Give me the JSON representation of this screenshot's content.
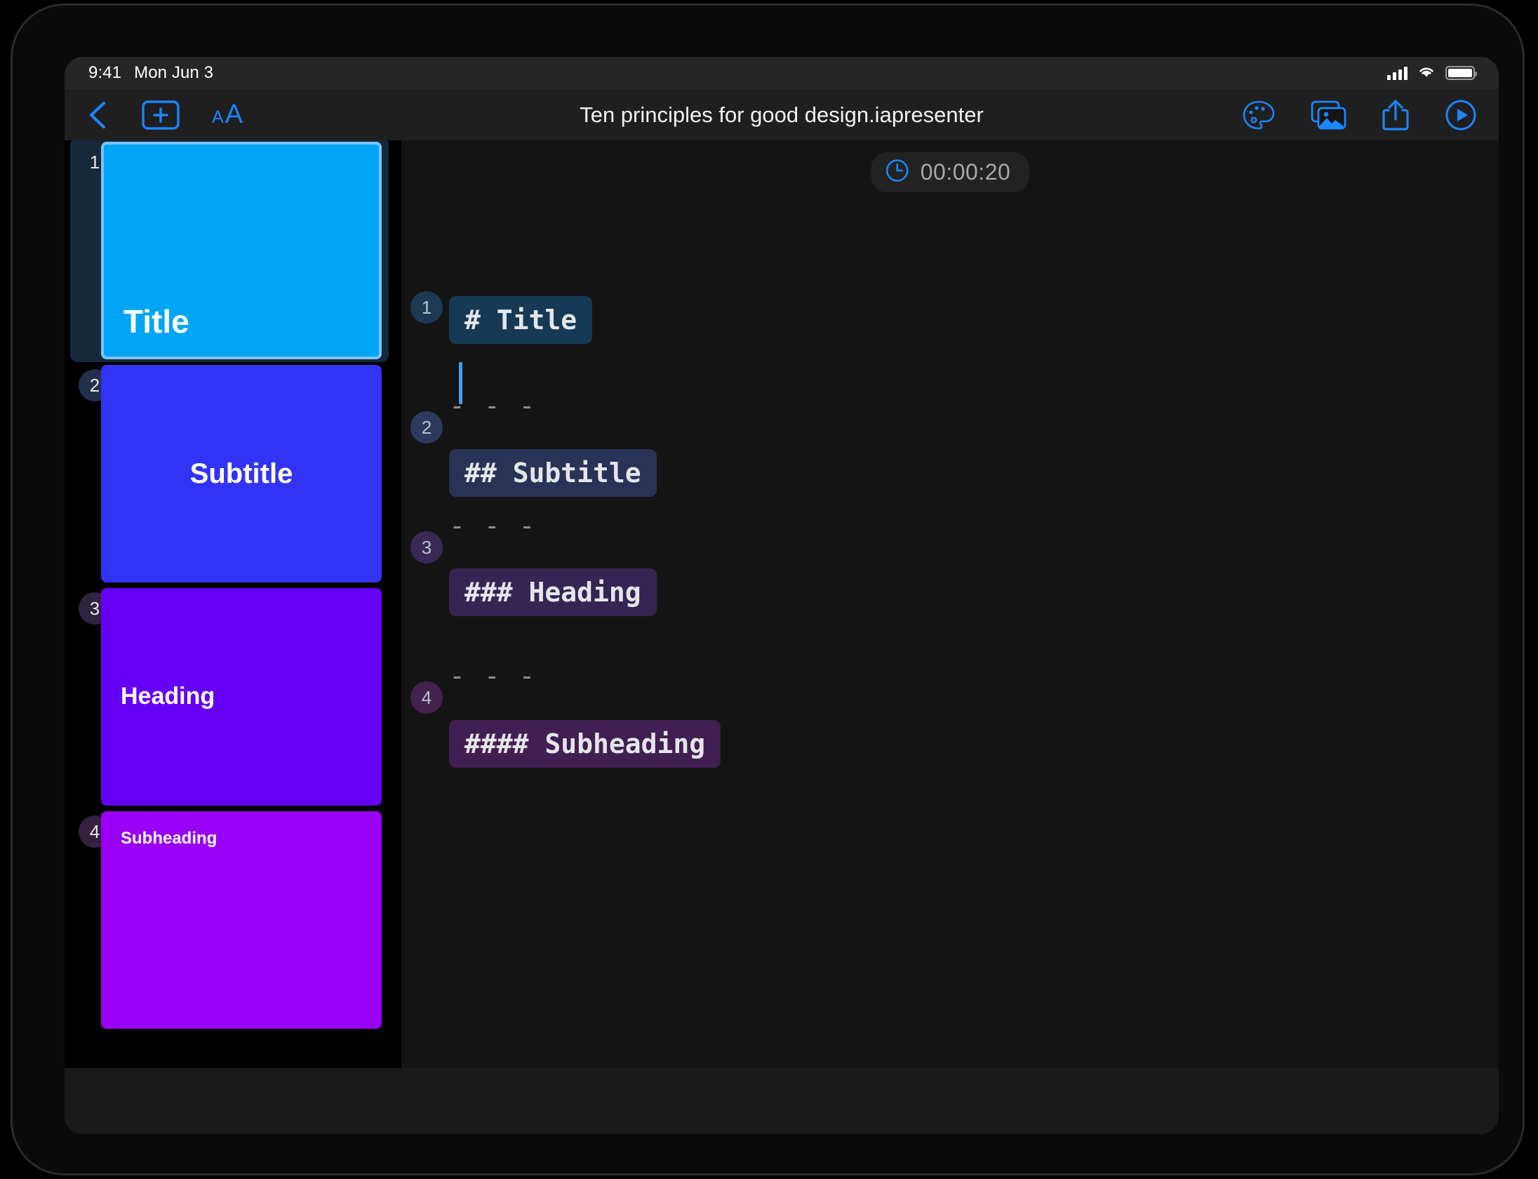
{
  "status_bar": {
    "time": "9:41",
    "date": "Mon Jun 3",
    "icons": [
      "cellular-signal-icon",
      "wifi-icon",
      "battery-icon"
    ]
  },
  "toolbar": {
    "back_icon": "chevron-left-icon",
    "add_slide_icon": "add-slide-icon",
    "text_size_small": "A",
    "text_size_large": "A",
    "document_title": "Ten principles for good design.iapresenter",
    "theme_icon": "palette-icon",
    "media_icon": "photos-icon",
    "share_icon": "share-icon",
    "play_icon": "play-icon"
  },
  "timer": {
    "icon": "clock-icon",
    "value": "00:00:20"
  },
  "sidebar": {
    "slides": [
      {
        "number": "1",
        "text": "Title",
        "bg": "#00A5F5",
        "selected": true,
        "align": "pos-bl",
        "font_size": "46px"
      },
      {
        "number": "2",
        "text": "Subtitle",
        "bg": "#3333F5",
        "selected": false,
        "align": "pos-c",
        "font_size": "40px"
      },
      {
        "number": "3",
        "text": "Heading",
        "bg": "#6600F5",
        "selected": false,
        "align": "pos-cl",
        "font_size": "34px"
      },
      {
        "number": "4",
        "text": "Subheading",
        "bg": "#9900F5",
        "selected": false,
        "align": "pos-tl",
        "font_size": "24px"
      }
    ],
    "badge_colors": [
      "#16293a",
      "#22304a",
      "#2d2440",
      "#34203f"
    ]
  },
  "editor": {
    "separator": "- - -",
    "blocks": [
      {
        "marker": "1",
        "text": "# Title",
        "pill_bg": "#163a55",
        "marker_bg": "#1d3a52",
        "show_separator_above": false
      },
      {
        "marker": "2",
        "text": "## Subtitle",
        "pill_bg": "#283355",
        "marker_bg": "#2c3a5e",
        "show_separator_above": true
      },
      {
        "marker": "3",
        "text": "### Heading",
        "pill_bg": "#342553",
        "marker_bg": "#382a55",
        "show_separator_above": true
      },
      {
        "marker": "4",
        "text": "#### Subheading",
        "pill_bg": "#411f52",
        "marker_bg": "#44224f",
        "show_separator_above": true
      }
    ],
    "caret_color": "#3fa0f5"
  },
  "colors": {
    "accent": "#1a86ff",
    "screen_bg": "#141414",
    "sidebar_bg": "#000000",
    "toolbar_bg": "#1f1f1f",
    "status_bg": "#262626"
  }
}
